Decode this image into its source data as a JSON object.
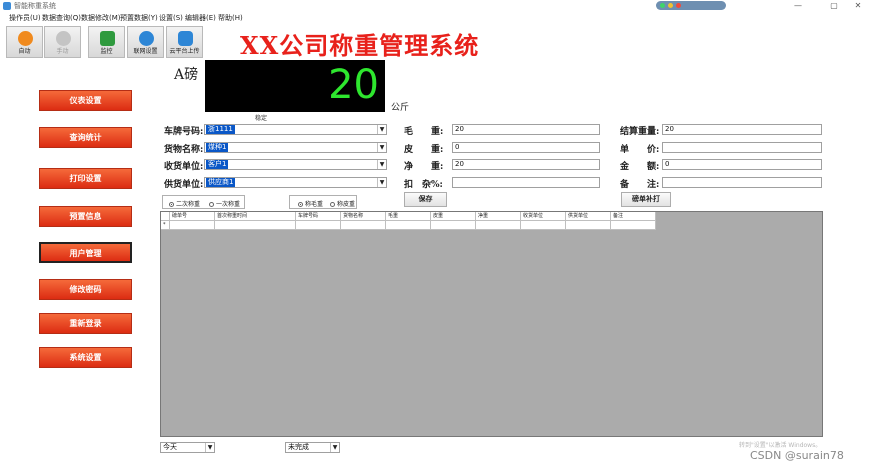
{
  "window": {
    "title": "智能称重系统",
    "controls": [
      "—",
      "▢",
      "✕"
    ],
    "tray_colors": [
      "#3fd46a",
      "#f2c230",
      "#f24a3a"
    ]
  },
  "menu": [
    "操作员(U)",
    "数据查询(Q)",
    "数据修改(M)",
    "预置数据(Y)",
    "设置(S)",
    "编辑器(E)",
    "帮助(H)"
  ],
  "toolbar": [
    {
      "label": "自动",
      "icon": "auto-icon",
      "color": "#f08a1e",
      "disabled": false
    },
    {
      "label": "手动",
      "icon": "manual-icon",
      "color": "#c4c4c4",
      "disabled": true
    },
    {
      "label": "监控",
      "icon": "monitor-icon",
      "color": "#2f9a3e",
      "disabled": false
    },
    {
      "label": "联网设置",
      "icon": "network-icon",
      "color": "#2d86d6",
      "disabled": false
    },
    {
      "label": "云平台上传",
      "icon": "cloud-upload-icon",
      "color": "#2d86d6",
      "disabled": false
    }
  ],
  "app_heading": "XX公司称重管理系统",
  "scale": {
    "label": "A磅",
    "value": "20",
    "unit": "公斤",
    "status": "稳定"
  },
  "sidebar": [
    {
      "label": "仪表设置",
      "selected": false
    },
    {
      "label": "查询统计",
      "selected": false
    },
    {
      "label": "打印设置",
      "selected": false
    },
    {
      "label": "预置信息",
      "selected": false
    },
    {
      "label": "用户管理",
      "selected": true
    },
    {
      "label": "修改密码",
      "selected": false
    },
    {
      "label": "重新登录",
      "selected": false
    },
    {
      "label": "系统设置",
      "selected": false
    }
  ],
  "form": {
    "plate": {
      "label": "车牌号码:",
      "value": "浙1111"
    },
    "goods": {
      "label": "货物名称:",
      "value": "煤种1"
    },
    "receiver": {
      "label": "收货单位:",
      "value": "客户1"
    },
    "supplier": {
      "label": "供货单位:",
      "value": "供应商1"
    },
    "gross": {
      "label": "毛　　重:",
      "value": "20"
    },
    "tare": {
      "label": "皮　　重:",
      "value": "0"
    },
    "net": {
      "label": "净　　重:",
      "value": "20"
    },
    "deduct": {
      "label": "扣　杂%:",
      "value": ""
    },
    "settle": {
      "label": "结算重量:",
      "value": "20"
    },
    "price": {
      "label": "单　　价:",
      "value": ""
    },
    "amount": {
      "label": "金　　额:",
      "value": "0"
    },
    "remark": {
      "label": "备　　注:",
      "value": ""
    }
  },
  "weigh_mode": {
    "options": [
      "二次称重",
      "一次称重"
    ],
    "selected": 0
  },
  "weigh_type": {
    "options": [
      "称毛重",
      "称皮重"
    ],
    "selected": 0
  },
  "buttons": {
    "save": "保存",
    "reprint": "磅单补打"
  },
  "table": {
    "columns": [
      "磅单号",
      "首次称重时间",
      "车牌号码",
      "货物名称",
      "毛重",
      "皮重",
      "净重",
      "收货单位",
      "供货单位",
      "备注"
    ],
    "new_row_marker": "*"
  },
  "filters": {
    "period": "今天",
    "status": "未完成"
  },
  "watermark": "转到\"设置\"以激活 Windows。",
  "csdn": "CSDN @surain78"
}
